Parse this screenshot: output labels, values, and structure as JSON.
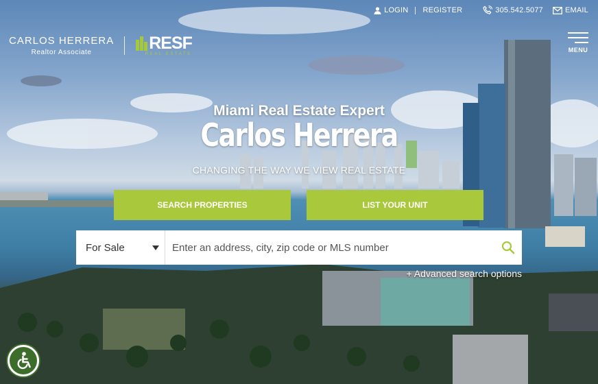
{
  "topbar": {
    "login": "LOGIN",
    "register": "REGISTER",
    "phone": "305.542.5077",
    "email": "EMAIL"
  },
  "brand": {
    "name": "CARLOS HERRERA",
    "title": "Realtor Associate",
    "logo_word": "RESF",
    "logo_sub": "REAL ESTATE"
  },
  "menu": {
    "label": "MENU"
  },
  "hero": {
    "kicker": "Miami Real Estate Expert",
    "name": "Carlos Herrera",
    "tagline": "CHANGING THE WAY WE VIEW REAL ESTATE"
  },
  "cta": {
    "search": "SEARCH PROPERTIES",
    "list": "LIST YOUR UNIT"
  },
  "search": {
    "mode": "For Sale",
    "placeholder": "Enter an address, city, zip code or MLS number",
    "advanced": "+ Advanced search options"
  },
  "colors": {
    "accent": "#a9c83c",
    "a11y": "#3d6d2b"
  },
  "icons": [
    "user-icon",
    "phone-icon",
    "envelope-icon",
    "menu-icon",
    "search-icon",
    "accessibility-icon"
  ]
}
